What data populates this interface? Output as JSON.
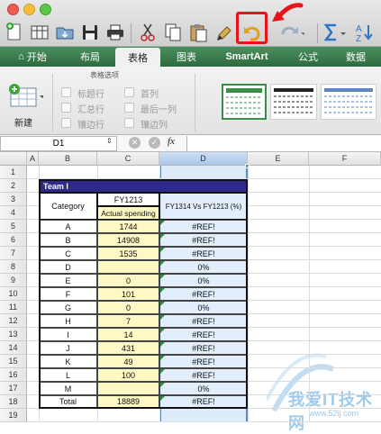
{
  "window": {
    "traffic_colors": [
      "#ee5b53",
      "#f5bd3d",
      "#5dc747"
    ]
  },
  "toolbar": {
    "buttons": [
      "new-icon",
      "gallery-icon",
      "open-icon",
      "save-icon",
      "print-icon",
      "cut-icon",
      "copy-icon",
      "paste-icon",
      "format-brush-icon",
      "undo-icon",
      "redo-icon",
      "sum-icon",
      "sort-icon"
    ],
    "highlight_color": "#e8141b"
  },
  "ribbon": {
    "home_label": "开始",
    "tabs": [
      "布局",
      "表格",
      "图表",
      "SmartArt",
      "公式",
      "数据"
    ],
    "active_tab": "表格"
  },
  "panel": {
    "group_title": "表格选项",
    "new_label": "新建",
    "options": [
      "标题行",
      "汇总行",
      "镶边行",
      "首列",
      "最后一列",
      "镶边列"
    ]
  },
  "formula_bar": {
    "name_box": "D1",
    "fx_label": "fx",
    "content": ""
  },
  "sheet": {
    "columns": [
      "A",
      "B",
      "C",
      "D",
      "E",
      "F"
    ],
    "rows": [
      "1",
      "2",
      "3",
      "4",
      "5",
      "6",
      "7",
      "8",
      "9",
      "10",
      "11",
      "12",
      "13",
      "14",
      "15",
      "16",
      "17",
      "18",
      "19"
    ],
    "selected_column": "D",
    "table": {
      "title": "Team I",
      "header_category": "Category",
      "header_fy": "FY1213",
      "header_actual": "Actual spending",
      "header_compare": "FY1314 Vs FY1213 (%)",
      "rows": [
        {
          "cat": "A",
          "val": "1744",
          "pct": "#REF!"
        },
        {
          "cat": "B",
          "val": "14908",
          "pct": "#REF!"
        },
        {
          "cat": "C",
          "val": "1535",
          "pct": "#REF!"
        },
        {
          "cat": "D",
          "val": "",
          "pct": "0%"
        },
        {
          "cat": "E",
          "val": "0",
          "pct": "0%"
        },
        {
          "cat": "F",
          "val": "101",
          "pct": "#REF!"
        },
        {
          "cat": "G",
          "val": "0",
          "pct": "0%"
        },
        {
          "cat": "H",
          "val": "7",
          "pct": "#REF!"
        },
        {
          "cat": "I",
          "val": "14",
          "pct": "#REF!"
        },
        {
          "cat": "J",
          "val": "431",
          "pct": "#REF!"
        },
        {
          "cat": "K",
          "val": "49",
          "pct": "#REF!"
        },
        {
          "cat": "L",
          "val": "100",
          "pct": "#REF!"
        },
        {
          "cat": "M",
          "val": "",
          "pct": "0%"
        },
        {
          "cat": "Total",
          "val": "18889",
          "pct": "#REF!"
        }
      ]
    }
  },
  "watermark": {
    "text": "我爱IT技术网",
    "url": "www.52ij.com"
  }
}
